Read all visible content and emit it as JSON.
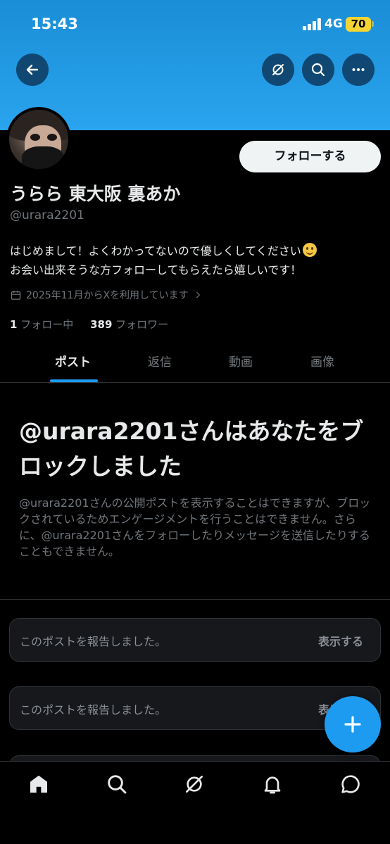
{
  "status_bar": {
    "time": "15:43",
    "network": "4G",
    "battery": "70"
  },
  "colors": {
    "accent": "#1d9bf0",
    "banner": "#2aa4ee",
    "background": "#000000",
    "muted": "#71767b"
  },
  "header": {
    "icons": [
      "back-arrow-icon",
      "grok-icon",
      "search-icon",
      "more-icon"
    ]
  },
  "profile": {
    "follow_label": "フォローする",
    "name": "うらら 東大阪 裏あか",
    "handle": "@urara2201",
    "bio_line1": "はじめまして！よくわかってないので優しくしてください",
    "bio_line2": "お会い出来そうな方フォローしてもらえたら嬉しいです！",
    "joined": "2025年11月からXを利用しています",
    "following_count": "1",
    "following_label": "フォロー中",
    "followers_count": "389",
    "followers_label": "フォロワー"
  },
  "tabs": [
    {
      "label": "ポスト",
      "active": true
    },
    {
      "label": "返信",
      "active": false
    },
    {
      "label": "動画",
      "active": false
    },
    {
      "label": "画像",
      "active": false
    }
  ],
  "blocked": {
    "title": "@urara2201さんはあなたをブロックしました",
    "text": "@urara2201さんの公開ポストを表示することはできますが、ブロックされているためエンゲージメントを行うことはできません。さらに、@urara2201さんをフォローしたりメッセージを送信したりすることもできません。"
  },
  "reported_posts": [
    {
      "message": "このポストを報告しました。",
      "action": "表示する"
    },
    {
      "message": "このポストを報告しました。",
      "action": "表示する"
    }
  ],
  "bottom_nav": [
    "home-icon",
    "search-icon",
    "grok-icon",
    "notifications-icon",
    "messages-icon"
  ]
}
